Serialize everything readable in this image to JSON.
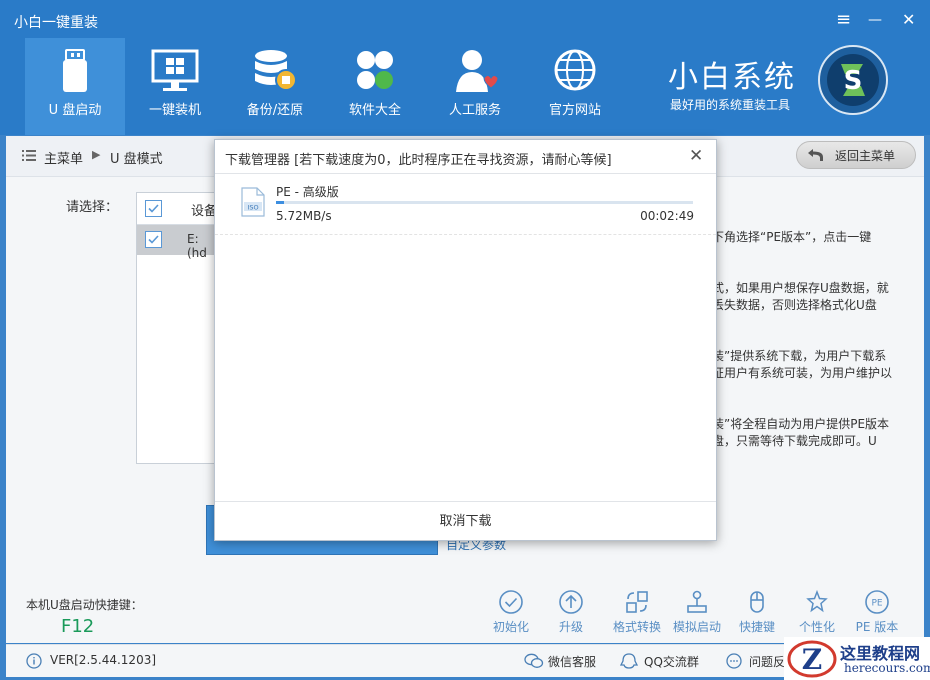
{
  "window": {
    "title": "小白一键重装",
    "controls": {
      "menu": "≡",
      "minimize": "—",
      "close": "✕"
    }
  },
  "nav": {
    "items": [
      {
        "label": "U 盘启动",
        "icon": "usb-drive-icon",
        "active": true
      },
      {
        "label": "一键装机",
        "icon": "monitor-windows-icon",
        "active": false
      },
      {
        "label": "备份/还原",
        "icon": "database-backup-icon",
        "active": false
      },
      {
        "label": "软件大全",
        "icon": "software-grid-icon",
        "active": false
      },
      {
        "label": "人工服务",
        "icon": "person-heart-icon",
        "active": false
      },
      {
        "label": "官方网站",
        "icon": "globe-icon",
        "active": false
      }
    ]
  },
  "brand": {
    "name": "小白系统",
    "tagline": "最好用的系统重装工具"
  },
  "breadcrumb": {
    "root": "主菜单",
    "separator": "▶",
    "current": "U 盘模式"
  },
  "back_button": {
    "label": "返回主菜单"
  },
  "main": {
    "choose_label": "请选择：",
    "device_table": {
      "header": "设备",
      "row": "E:(hd"
    },
    "custom_link": "自定义参数",
    "descriptions": [
      "下角选择“PE版本”，点击一键",
      "式，如果用户想保存U盘数据，就",
      "丢失数据，否则选择格式化U盘",
      "装”提供系统下载，为用户下载系",
      "证用户有系统可装，为用户维护以",
      "装”将全程自动为用户提供PE版本",
      "盘，只需等待下载完成即可。U"
    ]
  },
  "hotkey": {
    "label": "本机U盘启动快捷键：",
    "value": "F12"
  },
  "tools": [
    {
      "label": "初始化",
      "icon": "check-circle-icon"
    },
    {
      "label": "升级",
      "icon": "arrow-up-circle-icon"
    },
    {
      "label": "格式转换",
      "icon": "convert-icon"
    },
    {
      "label": "模拟启动",
      "icon": "joystick-icon"
    },
    {
      "label": "快捷键",
      "icon": "mouse-icon"
    },
    {
      "label": "个性化",
      "icon": "star-settings-icon"
    },
    {
      "label": "PE 版本",
      "icon": "pe-badge-icon"
    }
  ],
  "footer": {
    "version": "VER[2.5.44.1203]",
    "wechat": "微信客服",
    "qq": "QQ交流群",
    "feedback": "问题反"
  },
  "modal": {
    "title": "下载管理器 [若下载速度为0，此时程序正在寻找资源，请耐心等候]",
    "close": "✕",
    "item": {
      "name": "PE - 高级版",
      "icon_text": "ISO",
      "progress": 0.02,
      "speed": "5.72MB/s",
      "elapsed": "00:02:49"
    },
    "cancel": "取消下载"
  },
  "watermark": {
    "logo_letter": "Z",
    "name": "这里教程网",
    "url": "herecours.com"
  },
  "colors": {
    "header": "#2a7bc8",
    "active_tab": "#3f90d9",
    "accent": "#3c8ee0",
    "hotkey": "#1a9a5a"
  }
}
